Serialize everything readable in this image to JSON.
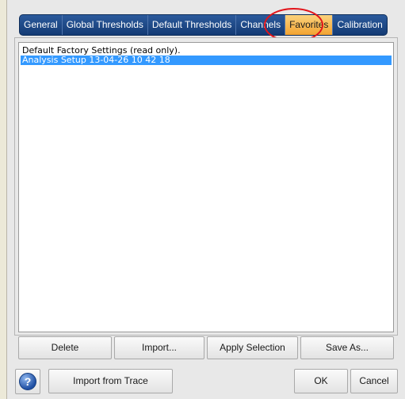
{
  "tabs": [
    {
      "label": "General",
      "active": false
    },
    {
      "label": "Global Thresholds",
      "active": false
    },
    {
      "label": "Default Thresholds",
      "active": false
    },
    {
      "label": "Channels",
      "active": false
    },
    {
      "label": "Favorites",
      "active": true
    },
    {
      "label": "Calibration",
      "active": false
    }
  ],
  "favorites": {
    "items": [
      {
        "label": "Default Factory Settings (read only).",
        "selected": false
      },
      {
        "label": "Analysis Setup 13-04-26 10 42 18",
        "selected": true
      }
    ],
    "buttons": {
      "delete": "Delete",
      "import": "Import...",
      "apply": "Apply Selection",
      "save_as": "Save As..."
    }
  },
  "footer": {
    "help_icon": "?",
    "import_trace": "Import from Trace",
    "ok": "OK",
    "cancel": "Cancel"
  },
  "colors": {
    "tab_bg": "#17407a",
    "tab_active": "#f2a331",
    "selection": "#3399ff",
    "highlight_ring": "#e2141a"
  }
}
